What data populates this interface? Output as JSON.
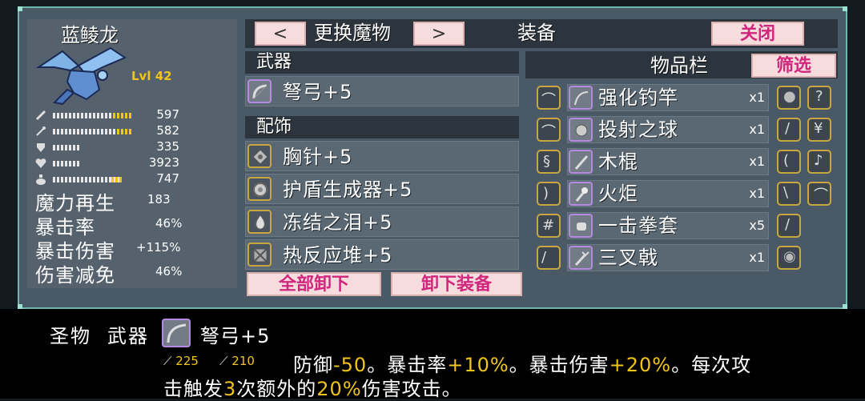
{
  "monster": {
    "name": "蓝鲮龙",
    "level": "Lvl 42",
    "stats": [
      {
        "icon": "sword-icon",
        "value": "597",
        "fill": 0.25
      },
      {
        "icon": "wand-icon",
        "value": "582",
        "fill": 0.2
      },
      {
        "icon": "shield-icon",
        "value": "335",
        "fill": 0.0
      },
      {
        "icon": "heart-icon",
        "value": "3923",
        "fill": 0.0
      },
      {
        "icon": "flask-icon",
        "value": "747",
        "fill": 0.15
      }
    ],
    "extra_stats": [
      {
        "label": "魔力再生",
        "value": "183"
      },
      {
        "label": "暴击率",
        "value": "46%"
      },
      {
        "label": "暴击伤害",
        "value": "+115%"
      },
      {
        "label": "伤害减免",
        "value": "46%"
      }
    ]
  },
  "nav": {
    "prev": "<",
    "title": "更换魔物",
    "next": ">",
    "equip_title": "装备",
    "close": "关闭"
  },
  "weapon": {
    "header": "武器",
    "item": "弩弓+5"
  },
  "accessory": {
    "header": "配饰",
    "items": [
      "胸针+5",
      "护盾生成器+5",
      "冻结之泪+5",
      "热反应堆+5"
    ]
  },
  "actions": {
    "unequip_all": "全部卸下",
    "unequip": "卸下装备"
  },
  "inventory": {
    "header": "物品栏",
    "filter": "筛选",
    "items": [
      {
        "label": "强化钓竿",
        "count": "x1"
      },
      {
        "label": "投射之球",
        "count": "x1"
      },
      {
        "label": "木棍",
        "count": "x1"
      },
      {
        "label": "火炬",
        "count": "x1"
      },
      {
        "label": "一击拳套",
        "count": "x5"
      },
      {
        "label": "三叉戟",
        "count": "x1"
      }
    ]
  },
  "tooltip": {
    "category": "圣物",
    "type": "武器",
    "name": "弩弓+5",
    "atk": "225",
    "mag": "210",
    "line1_a": "防御",
    "line1_b": "-50",
    "line1_c": "。暴击率",
    "line1_d": "+10%",
    "line1_e": "。暴击伤害",
    "line1_f": "+20%",
    "line1_g": "。每次攻",
    "line2_a": "击触发",
    "line2_b": "3",
    "line2_c": "次额外的",
    "line2_d": "20%",
    "line2_e": "伤害攻击。"
  },
  "colors": {
    "frame": "#6fb7ad",
    "highlight": "#f0c419",
    "button_text": "#d1267d"
  }
}
